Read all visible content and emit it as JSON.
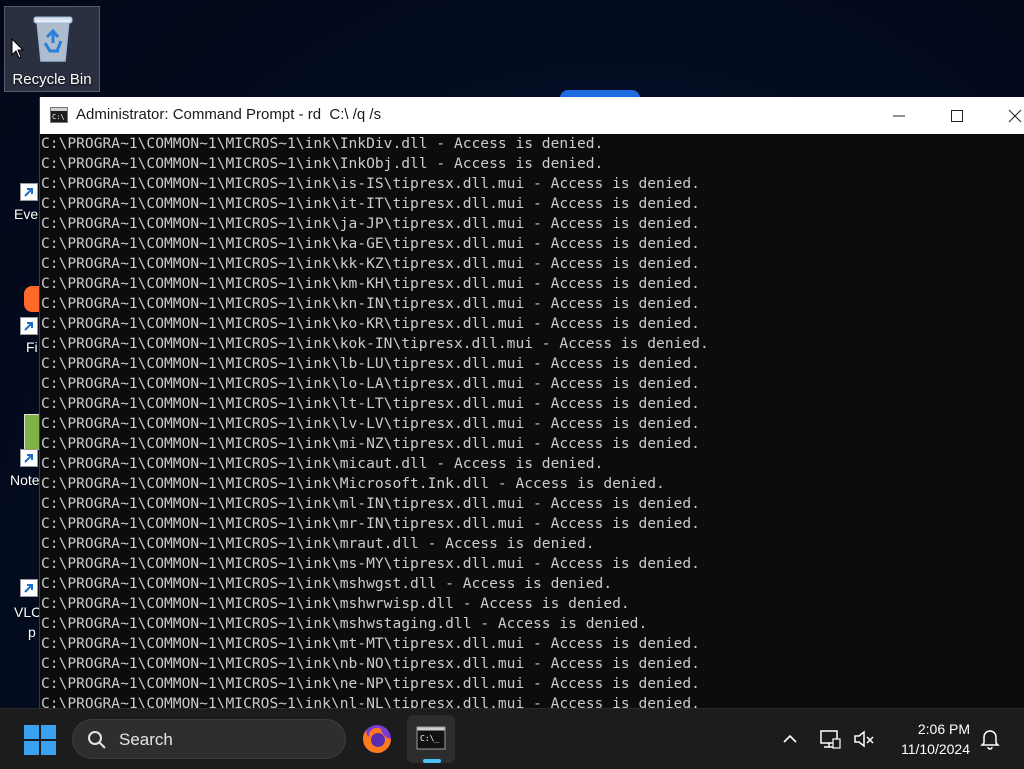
{
  "desktop": {
    "recycle_bin_label": "Recycle Bin",
    "partial_labels": [
      "Ever",
      "Fi",
      "Note",
      "VLC",
      "p"
    ]
  },
  "window": {
    "title": "Administrator: Command Prompt - rd  C:\\ /q /s",
    "controls": [
      "minimize",
      "maximize",
      "close"
    ]
  },
  "console": {
    "lines": [
      "C:\\PROGRA~1\\COMMON~1\\MICROS~1\\ink\\InkDiv.dll - Access is denied.",
      "C:\\PROGRA~1\\COMMON~1\\MICROS~1\\ink\\InkObj.dll - Access is denied.",
      "C:\\PROGRA~1\\COMMON~1\\MICROS~1\\ink\\is-IS\\tipresx.dll.mui - Access is denied.",
      "C:\\PROGRA~1\\COMMON~1\\MICROS~1\\ink\\it-IT\\tipresx.dll.mui - Access is denied.",
      "C:\\PROGRA~1\\COMMON~1\\MICROS~1\\ink\\ja-JP\\tipresx.dll.mui - Access is denied.",
      "C:\\PROGRA~1\\COMMON~1\\MICROS~1\\ink\\ka-GE\\tipresx.dll.mui - Access is denied.",
      "C:\\PROGRA~1\\COMMON~1\\MICROS~1\\ink\\kk-KZ\\tipresx.dll.mui - Access is denied.",
      "C:\\PROGRA~1\\COMMON~1\\MICROS~1\\ink\\km-KH\\tipresx.dll.mui - Access is denied.",
      "C:\\PROGRA~1\\COMMON~1\\MICROS~1\\ink\\kn-IN\\tipresx.dll.mui - Access is denied.",
      "C:\\PROGRA~1\\COMMON~1\\MICROS~1\\ink\\ko-KR\\tipresx.dll.mui - Access is denied.",
      "C:\\PROGRA~1\\COMMON~1\\MICROS~1\\ink\\kok-IN\\tipresx.dll.mui - Access is denied.",
      "C:\\PROGRA~1\\COMMON~1\\MICROS~1\\ink\\lb-LU\\tipresx.dll.mui - Access is denied.",
      "C:\\PROGRA~1\\COMMON~1\\MICROS~1\\ink\\lo-LA\\tipresx.dll.mui - Access is denied.",
      "C:\\PROGRA~1\\COMMON~1\\MICROS~1\\ink\\lt-LT\\tipresx.dll.mui - Access is denied.",
      "C:\\PROGRA~1\\COMMON~1\\MICROS~1\\ink\\lv-LV\\tipresx.dll.mui - Access is denied.",
      "C:\\PROGRA~1\\COMMON~1\\MICROS~1\\ink\\mi-NZ\\tipresx.dll.mui - Access is denied.",
      "C:\\PROGRA~1\\COMMON~1\\MICROS~1\\ink\\micaut.dll - Access is denied.",
      "C:\\PROGRA~1\\COMMON~1\\MICROS~1\\ink\\Microsoft.Ink.dll - Access is denied.",
      "C:\\PROGRA~1\\COMMON~1\\MICROS~1\\ink\\ml-IN\\tipresx.dll.mui - Access is denied.",
      "C:\\PROGRA~1\\COMMON~1\\MICROS~1\\ink\\mr-IN\\tipresx.dll.mui - Access is denied.",
      "C:\\PROGRA~1\\COMMON~1\\MICROS~1\\ink\\mraut.dll - Access is denied.",
      "C:\\PROGRA~1\\COMMON~1\\MICROS~1\\ink\\ms-MY\\tipresx.dll.mui - Access is denied.",
      "C:\\PROGRA~1\\COMMON~1\\MICROS~1\\ink\\mshwgst.dll - Access is denied.",
      "C:\\PROGRA~1\\COMMON~1\\MICROS~1\\ink\\mshwrwisp.dll - Access is denied.",
      "C:\\PROGRA~1\\COMMON~1\\MICROS~1\\ink\\mshwstaging.dll - Access is denied.",
      "C:\\PROGRA~1\\COMMON~1\\MICROS~1\\ink\\mt-MT\\tipresx.dll.mui - Access is denied.",
      "C:\\PROGRA~1\\COMMON~1\\MICROS~1\\ink\\nb-NO\\tipresx.dll.mui - Access is denied.",
      "C:\\PROGRA~1\\COMMON~1\\MICROS~1\\ink\\ne-NP\\tipresx.dll.mui - Access is denied.",
      "C:\\PROGRA~1\\COMMON~1\\MICROS~1\\ink\\nl-NL\\tipresx.dll.mui - Access is denied."
    ]
  },
  "taskbar": {
    "search_label": "Search",
    "time": "2:06 PM",
    "date": "11/10/2024",
    "apps": [
      "firefox-icon",
      "command-prompt-icon"
    ]
  },
  "colors": {
    "console_bg": "#0c0c0c",
    "console_fg": "#cccccc",
    "taskbar_bg": "#1c1c1c",
    "accent": "#4cc2ff"
  }
}
